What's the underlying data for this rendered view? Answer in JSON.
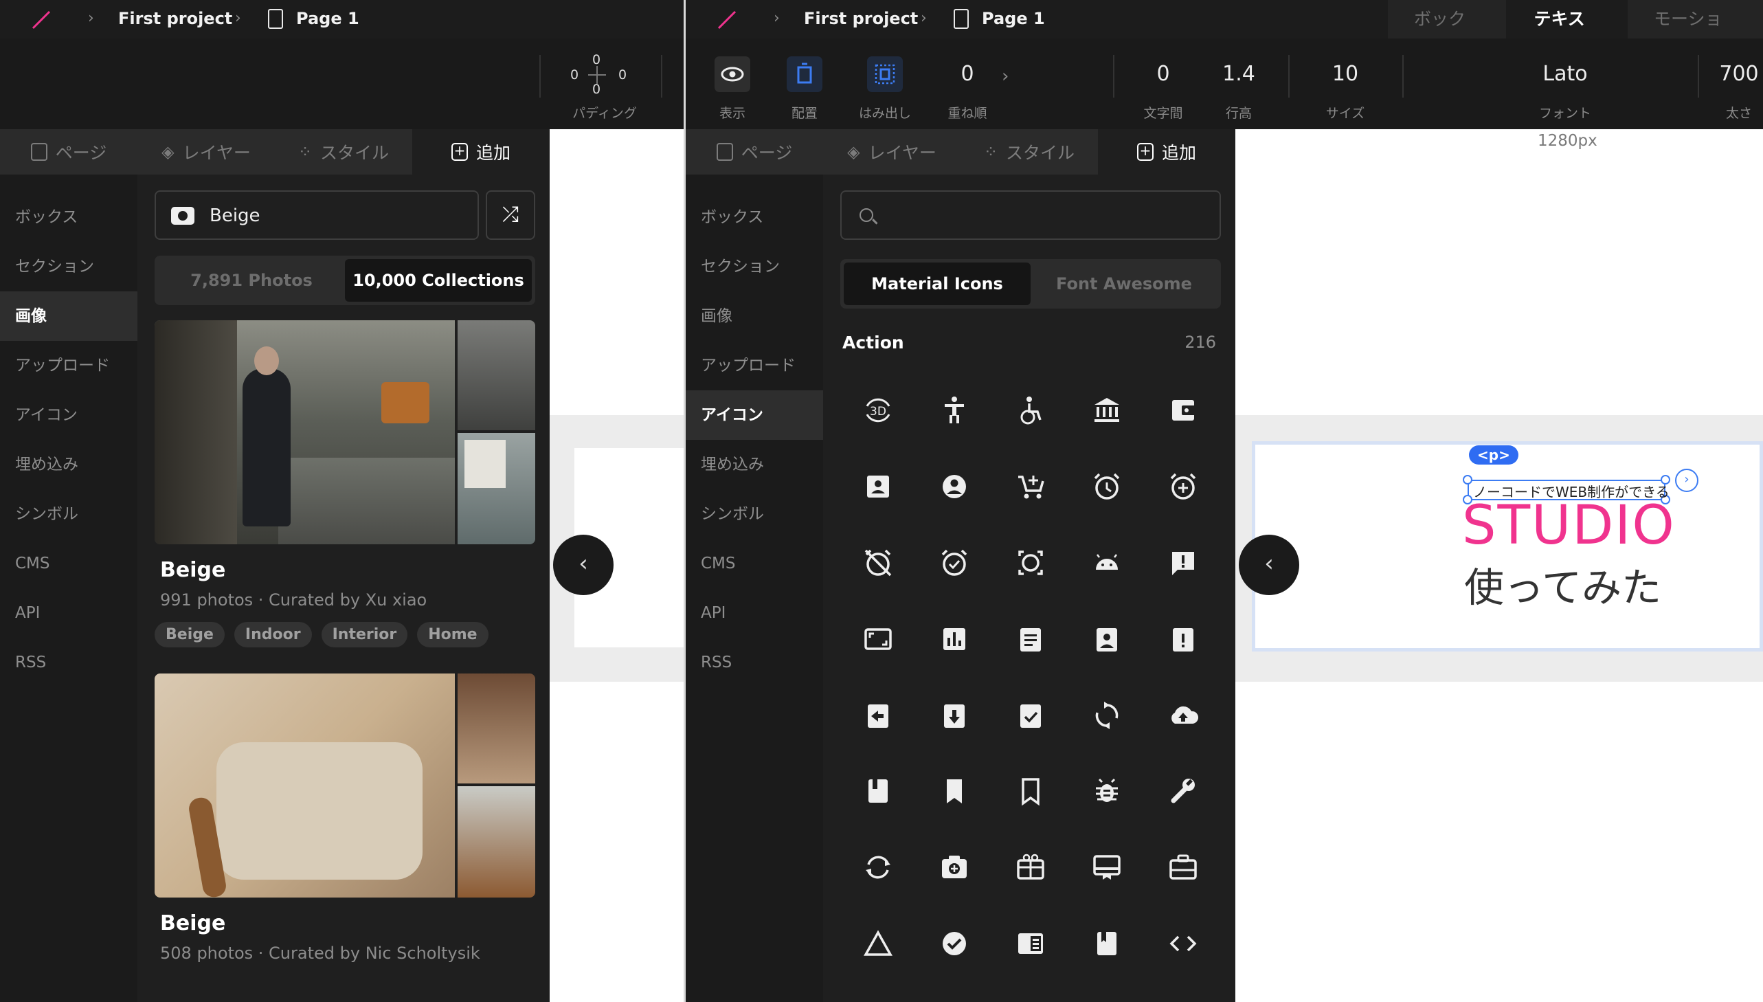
{
  "colors": {
    "brand_pink": "#f0338e",
    "accent_blue": "#2f6cf2",
    "panel_bg": "#1f1f1f",
    "sidebar_bg": "#1b1b1b"
  },
  "left_pane": {
    "breadcrumb": {
      "project": "First project",
      "page": "Page 1"
    },
    "toolbar": {
      "padding": {
        "top": "0",
        "left": "0",
        "right": "0",
        "bottom": "0",
        "label": "パディング"
      }
    },
    "panel_tabs": [
      "ページ",
      "レイヤー",
      "スタイル",
      "追加"
    ],
    "categories": [
      "ボックス",
      "セクション",
      "画像",
      "アップロード",
      "アイコン",
      "埋め込み",
      "シンボル",
      "CMS",
      "API",
      "RSS"
    ],
    "active_category": "画像",
    "search": {
      "value": "Beige",
      "icon": "camera-icon",
      "shuffle_icon": "shuffle-icon"
    },
    "segment": {
      "photos": "7,891 Photos",
      "collections": "10,000 Collections"
    },
    "collections": [
      {
        "title": "Beige",
        "meta": "991 photos · Curated by Xu xiao",
        "tags": [
          "Beige",
          "Indoor",
          "Interior",
          "Home"
        ]
      },
      {
        "title": "Beige",
        "meta": "508 photos · Curated by Nic Scholtysik",
        "tags": []
      }
    ]
  },
  "right_pane": {
    "breadcrumb": {
      "project": "First project",
      "page": "Page 1"
    },
    "mode_tabs": [
      "ボックス",
      "テキスト",
      "モーション"
    ],
    "active_mode": "テキスト",
    "toolbar": {
      "view": "表示",
      "align": "配置",
      "overflow": "はみ出し",
      "z_index": {
        "value": "0",
        "label": "重ね順"
      },
      "letter_spacing": {
        "value": "0",
        "label": "文字間"
      },
      "line_height": {
        "value": "1.4",
        "label": "行高"
      },
      "size": {
        "value": "10",
        "label": "サイズ"
      },
      "font": {
        "value": "Lato",
        "label": "フォント"
      },
      "weight": {
        "value": "700",
        "label": "太さ"
      }
    },
    "panel_tabs": [
      "ページ",
      "レイヤー",
      "スタイル",
      "追加"
    ],
    "categories": [
      "ボックス",
      "セクション",
      "画像",
      "アップロード",
      "アイコン",
      "埋め込み",
      "シンボル",
      "CMS",
      "API",
      "RSS"
    ],
    "active_category": "アイコン",
    "search": {
      "placeholder": ""
    },
    "icon_set": {
      "material": "Material Icons",
      "fontawesome": "Font Awesome"
    },
    "section": {
      "title": "Action",
      "count": "216"
    },
    "icons": [
      "3d-rotation-icon",
      "accessibility-icon",
      "accessible-icon",
      "account-balance-icon",
      "account-balance-wallet-icon",
      "account-box-icon",
      "account-circle-icon",
      "add-shopping-cart-icon",
      "alarm-icon",
      "alarm-add-icon",
      "alarm-off-icon",
      "alarm-on-icon",
      "all-out-icon",
      "android-icon",
      "announcement-icon",
      "aspect-ratio-icon",
      "assessment-icon",
      "assignment-icon",
      "assignment-ind-icon",
      "assignment-late-icon",
      "assignment-return-icon",
      "assignment-returned-icon",
      "assignment-turned-in-icon",
      "autorenew-icon",
      "backup-icon",
      "book-icon",
      "bookmark-icon",
      "bookmark-border-icon",
      "bug-report-icon",
      "build-icon",
      "cached-icon",
      "camera-enhance-icon",
      "card-giftcard-icon",
      "card-membership-icon",
      "card-travel-icon",
      "change-history-icon",
      "check-circle-icon",
      "chrome-reader-mode-icon",
      "class-icon",
      "code-icon"
    ],
    "canvas": {
      "width_label": "1280px",
      "p_tag": "<p>",
      "subtitle": "ノーコードでWEB制作ができる",
      "title": "STUDIO",
      "jp_title": "使ってみた"
    }
  }
}
